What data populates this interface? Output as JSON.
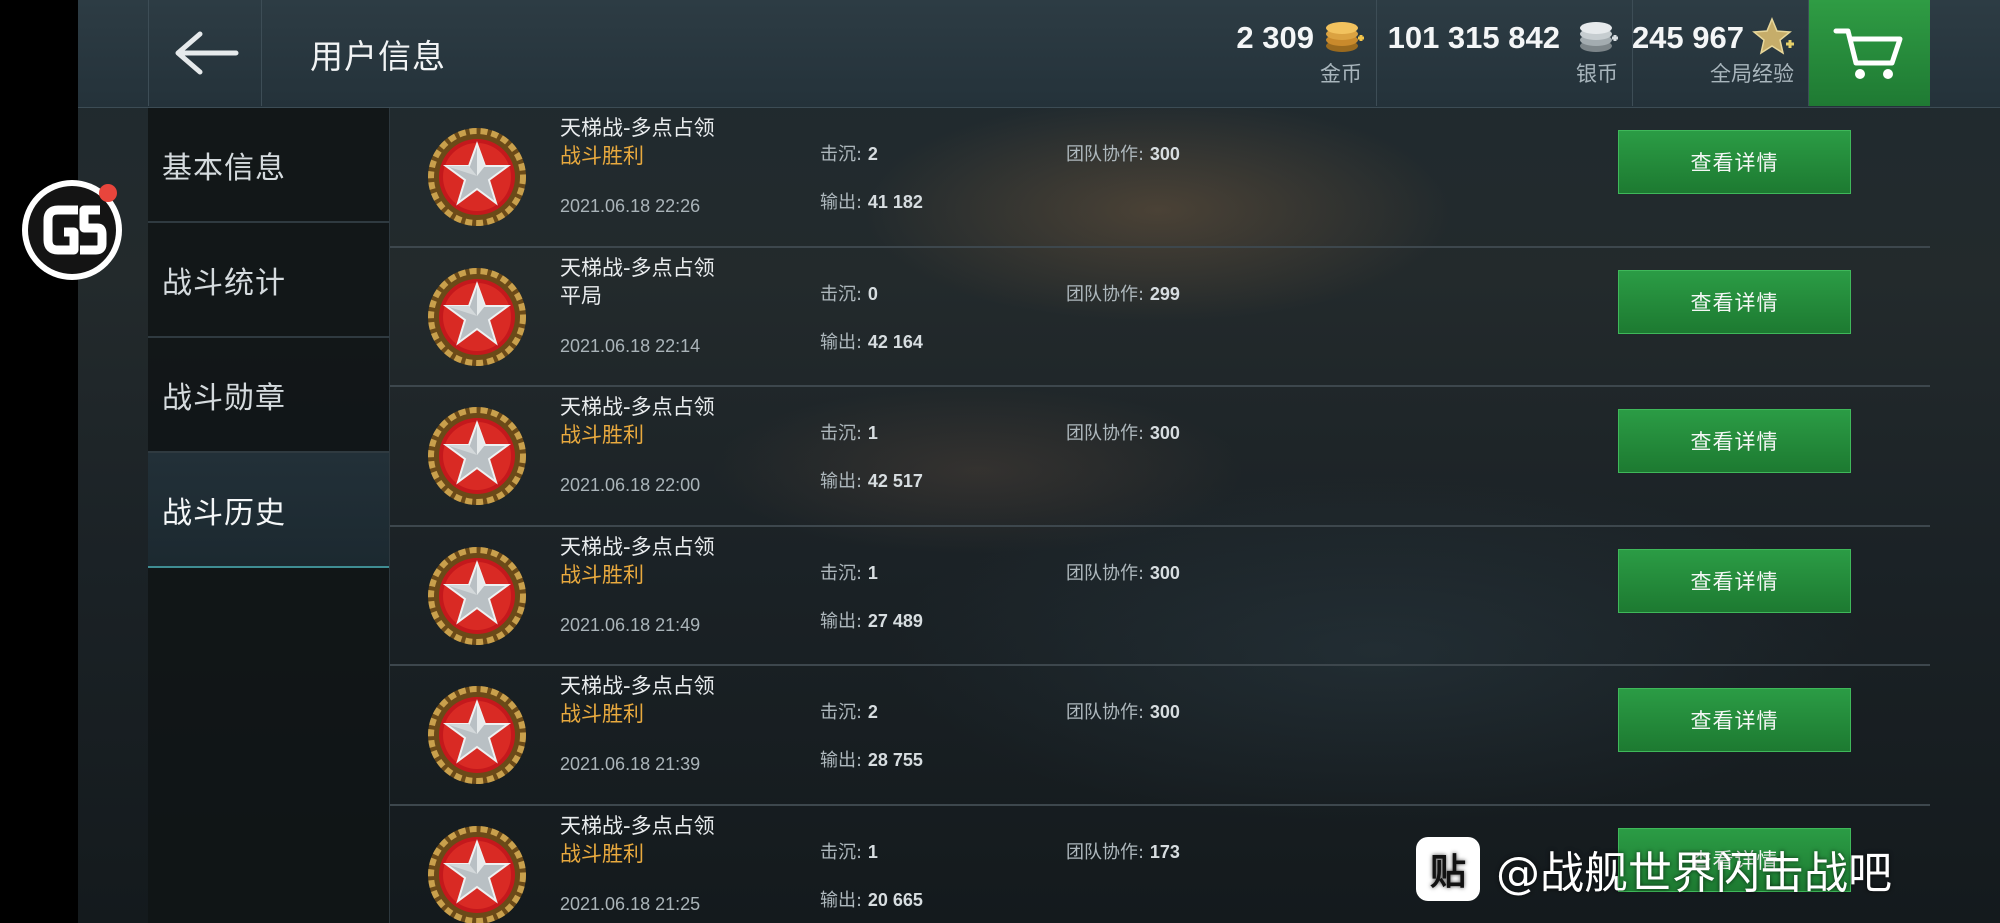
{
  "header": {
    "title": "用户信息",
    "currencies": [
      {
        "name": "gold",
        "amount": "2 309",
        "label": "金币"
      },
      {
        "name": "silver",
        "amount": "101 315 842",
        "label": "银币"
      },
      {
        "name": "xp",
        "amount": "245 967",
        "label": "全局经验"
      }
    ]
  },
  "sidebar": {
    "items": [
      {
        "label": "基本信息",
        "active": false
      },
      {
        "label": "战斗统计",
        "active": false
      },
      {
        "label": "战斗勋章",
        "active": false
      },
      {
        "label": "战斗历史",
        "active": true
      }
    ]
  },
  "battles": [
    {
      "mode": "天梯战-多点占领",
      "result": "战斗胜利",
      "date": "2021.06.18 22:26",
      "kills_label": "击沉:",
      "kills": "2",
      "damage_label": "输出:",
      "damage": "41 182",
      "team_label": "团队协作:",
      "team": "300",
      "button": "查看详情"
    },
    {
      "mode": "天梯战-多点占领",
      "result": "平局",
      "date": "2021.06.18 22:14",
      "kills_label": "击沉:",
      "kills": "0",
      "damage_label": "输出:",
      "damage": "42 164",
      "team_label": "团队协作:",
      "team": "299",
      "button": "查看详情"
    },
    {
      "mode": "天梯战-多点占领",
      "result": "战斗胜利",
      "date": "2021.06.18 22:00",
      "kills_label": "击沉:",
      "kills": "1",
      "damage_label": "输出:",
      "damage": "42 517",
      "team_label": "团队协作:",
      "team": "300",
      "button": "查看详情"
    },
    {
      "mode": "天梯战-多点占领",
      "result": "战斗胜利",
      "date": "2021.06.18 21:49",
      "kills_label": "击沉:",
      "kills": "1",
      "damage_label": "输出:",
      "damage": "27 489",
      "team_label": "团队协作:",
      "team": "300",
      "button": "查看详情"
    },
    {
      "mode": "天梯战-多点占领",
      "result": "战斗胜利",
      "date": "2021.06.18 21:39",
      "kills_label": "击沉:",
      "kills": "2",
      "damage_label": "输出:",
      "damage": "28 755",
      "team_label": "团队协作:",
      "team": "300",
      "button": "查看详情"
    },
    {
      "mode": "天梯战-多点占领",
      "result": "战斗胜利",
      "date": "2021.06.18 21:25",
      "kills_label": "击沉:",
      "kills": "1",
      "damage_label": "输出:",
      "damage": "20 665",
      "team_label": "团队协作:",
      "team": "173",
      "button": "查看详情"
    }
  ],
  "overlay": {
    "watermark": "@战舰世界闪击战吧",
    "zhihu_icon_text": "贴"
  },
  "colors": {
    "accent_green": "#2b9c45",
    "victory_orange": "#e8a93e",
    "active_underline": "#3f8d93"
  },
  "icons": [
    "back-arrow-icon",
    "gold-coins-icon",
    "silver-coins-icon",
    "star-xp-icon",
    "cart-icon",
    "victory-medal-icon",
    "gs-logo-icon",
    "zhihu-icon"
  ]
}
